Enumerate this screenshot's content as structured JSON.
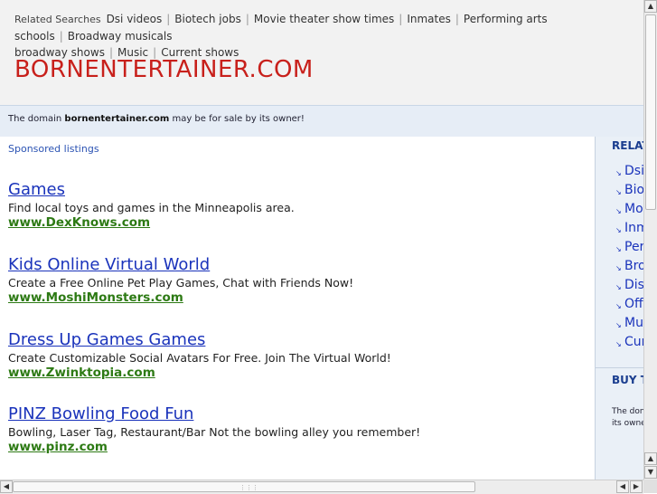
{
  "related_searches": {
    "label": "Related Searches",
    "items": [
      "Dsi videos",
      "Biotech jobs",
      "Movie theater show times",
      "Inmates",
      "Performing arts schools",
      "Broadway musicals",
      "broadway shows",
      "Music",
      "Current shows"
    ]
  },
  "site_title": "BORNENTERTAINER.COM",
  "sale_notice": {
    "prefix": "The domain",
    "domain": "bornentertainer.com",
    "suffix": "may be for sale by its owner!"
  },
  "sponsored_label": "Sponsored listings",
  "listings": [
    {
      "title": "Games",
      "desc": "Find local toys and games in the Minneapolis area.",
      "url": "www.DexKnows.com"
    },
    {
      "title": "Kids Online Virtual World",
      "desc": "Create a Free Online Pet Play Games, Chat with Friends Now!",
      "url": "www.MoshiMonsters.com"
    },
    {
      "title": "Dress Up Games Games",
      "desc": "Create Customizable Social Avatars For Free. Join The Virtual World!",
      "url": "www.Zwinktopia.com"
    },
    {
      "title": "PINZ Bowling Food Fun",
      "desc": "Bowling, Laser Tag, Restaurant/Bar Not the bowling alley you remember!",
      "url": "www.pinz.com"
    }
  ],
  "sidebar": {
    "heading": "RELAT",
    "items": [
      "Dsi",
      "Bio",
      "Mov",
      "Inm",
      "Per",
      "Bro",
      "Dis",
      "Off",
      "Mus",
      "Cur"
    ],
    "buy_heading": "BUY T",
    "buy_text_1": "The don",
    "buy_text_2": "its owne"
  },
  "icons": {
    "sidebar_bullet": "arrow-bullet-icon",
    "scroll_up": "triangle-up-icon",
    "scroll_down": "triangle-down-icon",
    "scroll_left": "triangle-left-icon",
    "scroll_right": "triangle-right-icon"
  },
  "colors": {
    "site_title": "#c8201b",
    "link": "#1a33bb",
    "url": "#2d7a14",
    "sale_bar": "#e6edf6",
    "sidebar_bg": "#eaf0f7"
  }
}
